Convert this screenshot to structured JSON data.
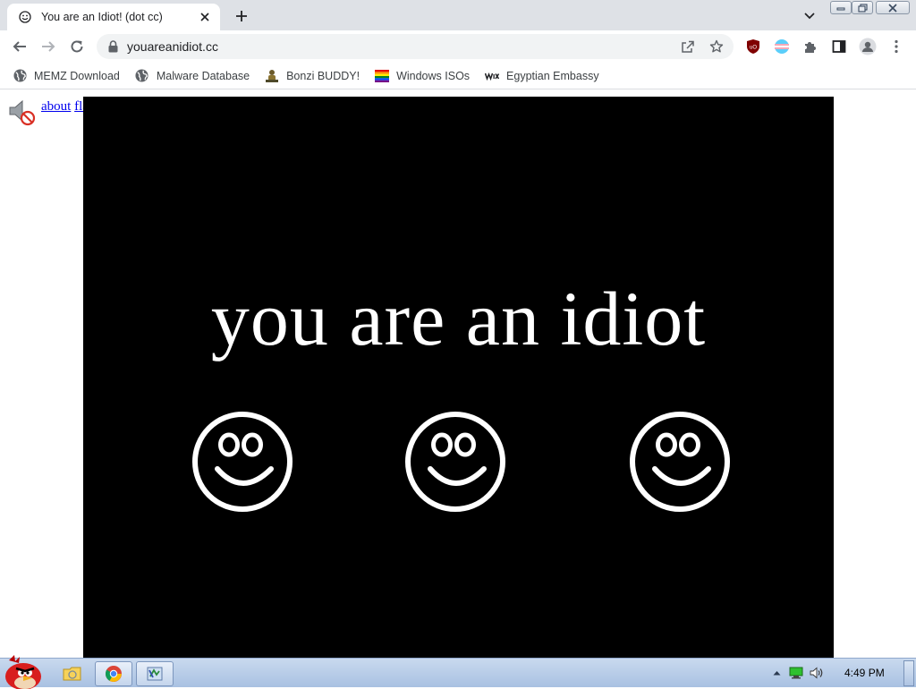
{
  "browser": {
    "tab": {
      "title": "You are an Idiot! (dot cc)",
      "favicon": "smiley-icon"
    },
    "new_tab_icon": "plus-icon",
    "url": "youareanidiot.cc",
    "toolbar_icons": [
      "back-arrow-icon",
      "forward-arrow-icon",
      "reload-icon",
      "share-icon",
      "star-icon",
      "ublock-icon",
      "extension-icon",
      "puzzle-icon",
      "sidepanel-icon",
      "profile-icon",
      "menu-icon"
    ]
  },
  "bookmarks": [
    {
      "label": "MEMZ Download",
      "icon": "globe-icon"
    },
    {
      "label": "Malware Database",
      "icon": "globe-icon"
    },
    {
      "label": "Bonzi BUDDY!",
      "icon": "bonzi-icon"
    },
    {
      "label": "Windows ISOs",
      "icon": "rainbow-flag-icon"
    },
    {
      "label": "Egyptian Embassy",
      "icon": "wix-icon"
    }
  ],
  "page": {
    "links": {
      "about": "about",
      "flash": "flash"
    },
    "headline": "you are an idiot",
    "smileys": 3
  },
  "taskbar": {
    "clock": "4:49 PM"
  }
}
